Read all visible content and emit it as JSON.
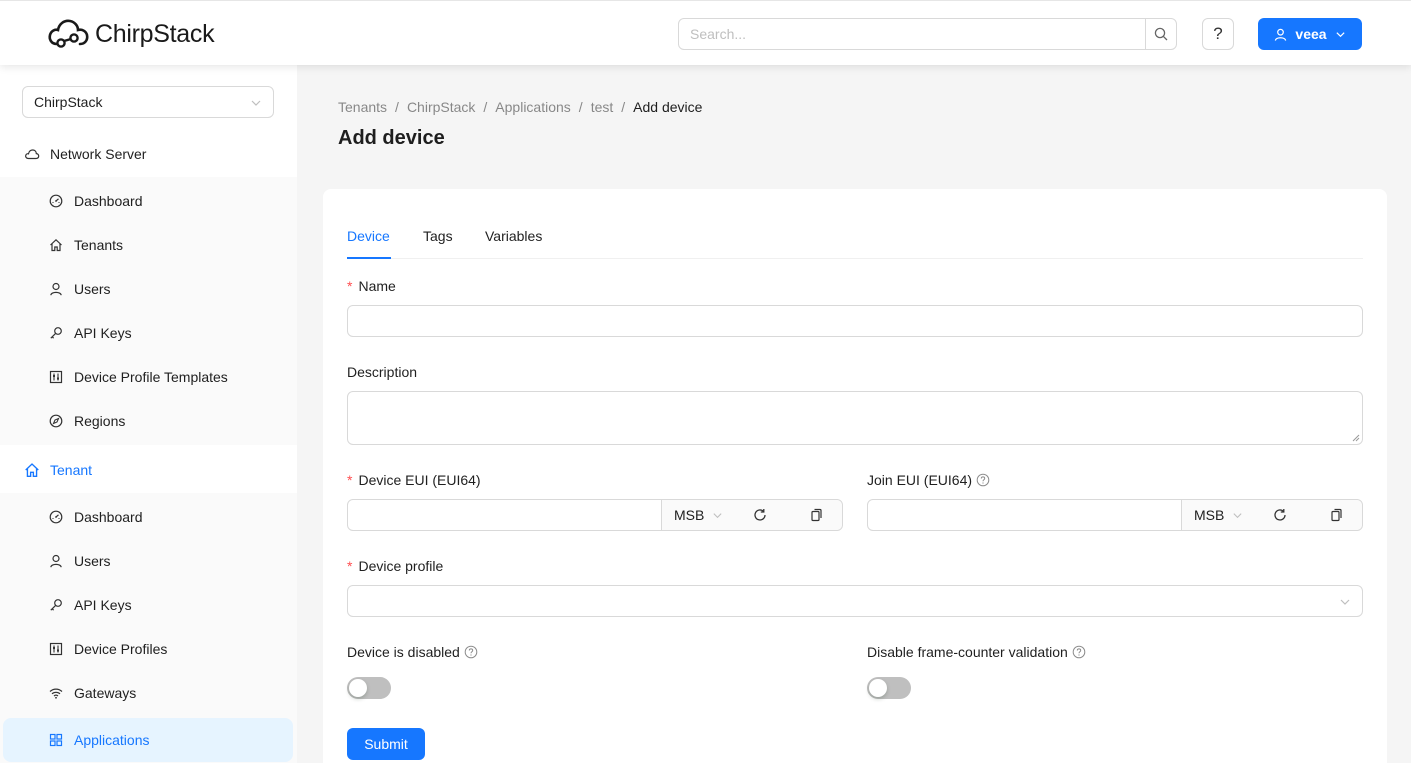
{
  "app": {
    "name": "ChirpStack"
  },
  "header": {
    "search_placeholder": "Search...",
    "help_label": "?",
    "user_label": "veea"
  },
  "sidebar": {
    "tenant_selected": "ChirpStack",
    "network_server": {
      "label": "Network Server",
      "items": [
        {
          "label": "Dashboard",
          "icon": "dashboard-icon"
        },
        {
          "label": "Tenants",
          "icon": "home-icon"
        },
        {
          "label": "Users",
          "icon": "user-icon"
        },
        {
          "label": "API Keys",
          "icon": "key-icon"
        },
        {
          "label": "Device Profile Templates",
          "icon": "control-icon"
        },
        {
          "label": "Regions",
          "icon": "compass-icon"
        }
      ]
    },
    "tenant": {
      "label": "Tenant",
      "items": [
        {
          "label": "Dashboard",
          "icon": "dashboard-icon"
        },
        {
          "label": "Users",
          "icon": "user-icon"
        },
        {
          "label": "API Keys",
          "icon": "key-icon"
        },
        {
          "label": "Device Profiles",
          "icon": "control-icon"
        },
        {
          "label": "Gateways",
          "icon": "wifi-icon"
        },
        {
          "label": "Applications",
          "icon": "appstore-icon",
          "selected": true
        }
      ]
    }
  },
  "breadcrumb": [
    "Tenants",
    "ChirpStack",
    "Applications",
    "test",
    "Add device"
  ],
  "page_title": "Add device",
  "tabs": [
    {
      "label": "Device",
      "active": true
    },
    {
      "label": "Tags"
    },
    {
      "label": "Variables"
    }
  ],
  "form": {
    "name": {
      "label": "Name",
      "value": ""
    },
    "description": {
      "label": "Description",
      "value": ""
    },
    "dev_eui": {
      "label": "Device EUI (EUI64)",
      "value": "",
      "byte_order": "MSB"
    },
    "join_eui": {
      "label": "Join EUI (EUI64)",
      "value": "",
      "byte_order": "MSB"
    },
    "device_profile": {
      "label": "Device profile",
      "value": ""
    },
    "is_disabled": {
      "label": "Device is disabled",
      "checked": false
    },
    "skip_fcnt": {
      "label": "Disable frame-counter validation",
      "checked": false
    },
    "submit_label": "Submit"
  },
  "colors": {
    "primary": "#1677ff",
    "required": "#ff4d4f"
  }
}
